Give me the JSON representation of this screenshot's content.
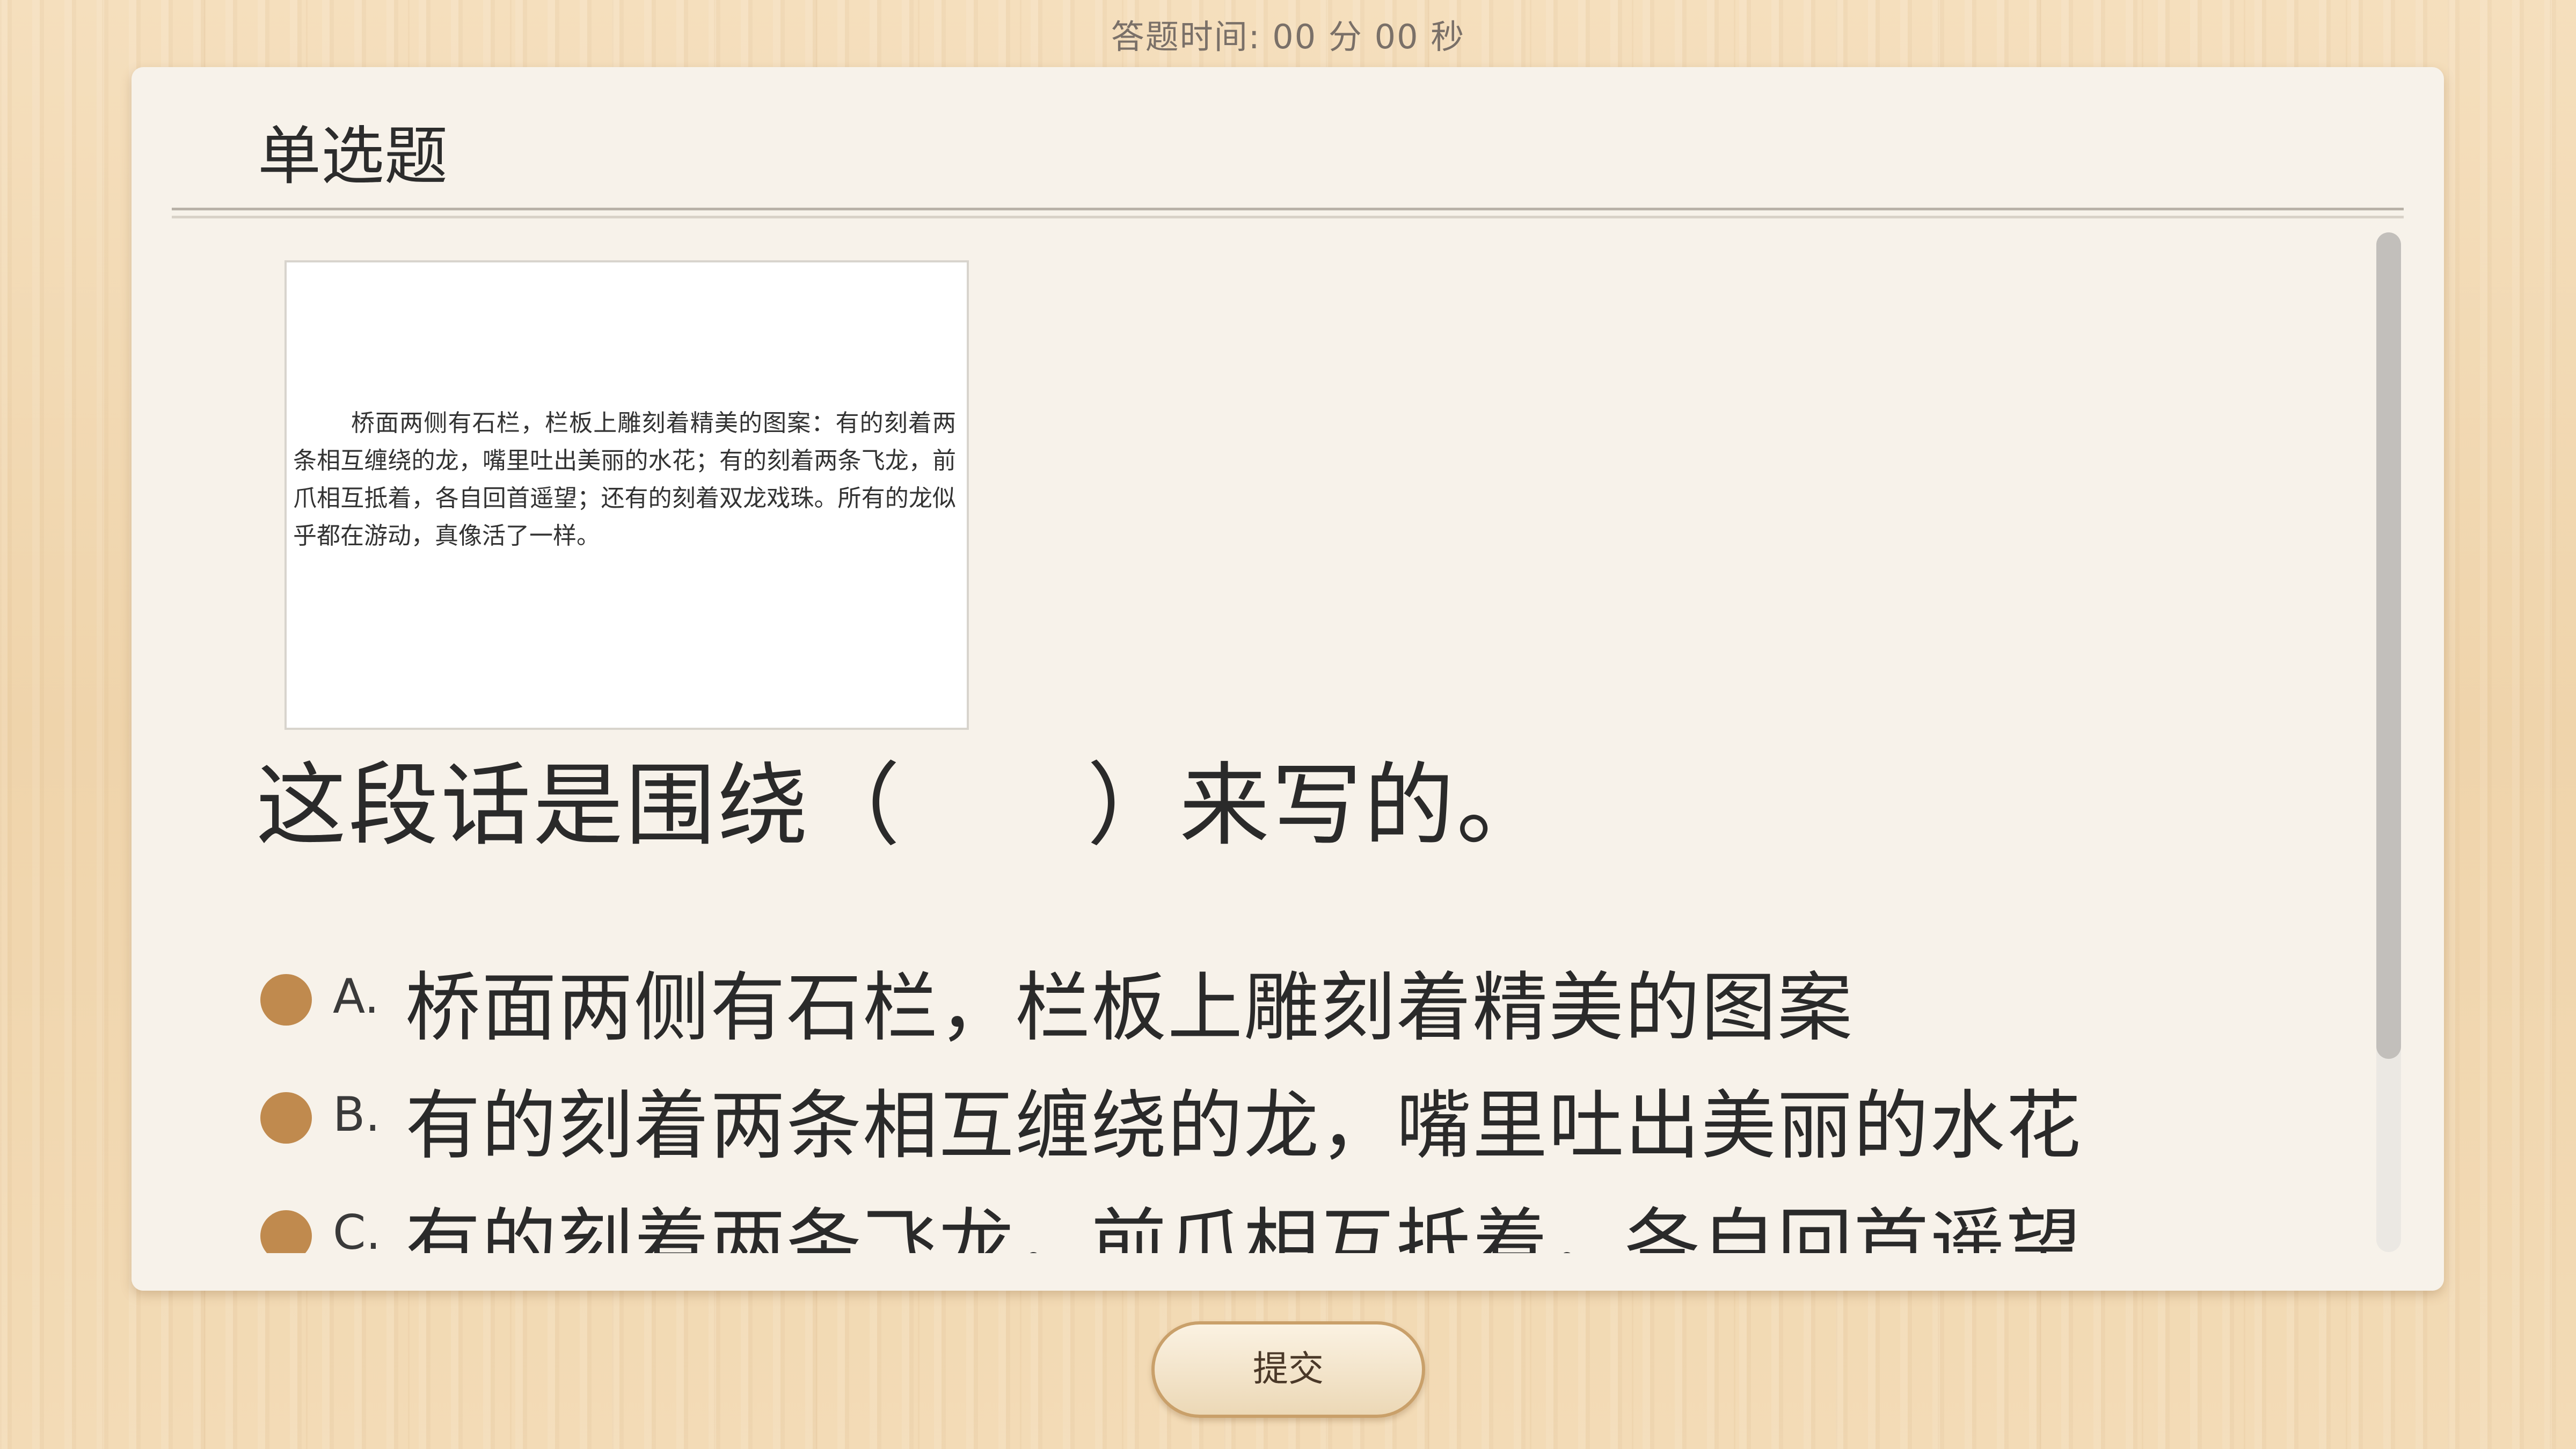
{
  "timer": {
    "label": "答题时间:",
    "minutes": "00",
    "minutes_unit": "分",
    "seconds": "00",
    "seconds_unit": "秒"
  },
  "card": {
    "title": "单选题"
  },
  "passage": {
    "text": "桥面两侧有石栏，栏板上雕刻着精美的图案：有的刻着两条相互缠绕的龙，嘴里吐出美丽的水花；有的刻着两条飞龙，前爪相互抵着，各自回首遥望；还有的刻着双龙戏珠。所有的龙似乎都在游动，真像活了一样。"
  },
  "question": {
    "text": "这段话是围绕（　　）来写的。"
  },
  "options": [
    {
      "letter": "A.",
      "text": "桥面两侧有石栏，栏板上雕刻着精美的图案"
    },
    {
      "letter": "B.",
      "text": "有的刻着两条相互缠绕的龙，嘴里吐出美丽的水花"
    },
    {
      "letter": "C.",
      "text": "有的刻着两条飞龙，前爪相互抵着，各自回首遥望"
    }
  ],
  "submit": {
    "label": "提交"
  },
  "colors": {
    "radio": "#c08a4e",
    "card_bg": "#f7f2ea",
    "wood_bg": "#f1d8b3"
  }
}
